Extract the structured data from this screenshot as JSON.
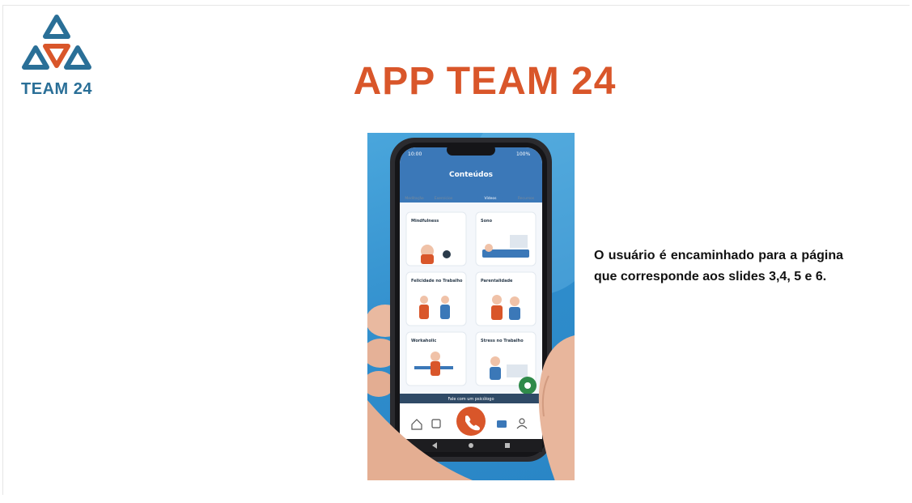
{
  "slide": {
    "title": "APP TEAM 24",
    "caption": "O usuário é encaminhado para a página que corresponde aos slides 3,4, 5 e 6."
  },
  "logo": {
    "text": "TEAM 24",
    "colors": {
      "primary": "#2a6f97",
      "accent": "#d9562a"
    }
  },
  "app_screen": {
    "header_title": "Conteúdos",
    "tabs": [
      "Meditação",
      "Exercícios",
      "Vídeos",
      "Recursos"
    ],
    "active_tab": "Vídeos",
    "cards": [
      {
        "title": "Mindfulness"
      },
      {
        "title": "Sono"
      },
      {
        "title": "Felicidade no Trabalho"
      },
      {
        "title": "Parentalidade"
      },
      {
        "title": "Workaholic"
      },
      {
        "title": "Stress no Trabalho"
      }
    ],
    "help_bar": "Fale com um psicólogo",
    "nav_icons": [
      "home-icon",
      "calendar-icon",
      "phone-icon",
      "folder-icon",
      "user-icon"
    ]
  },
  "colors": {
    "title": "#d9562a",
    "photo_background": "#2e8ccb",
    "app_header": "#3b78b8",
    "call_button": "#d9562a",
    "chat_button": "#2f8a4a"
  }
}
